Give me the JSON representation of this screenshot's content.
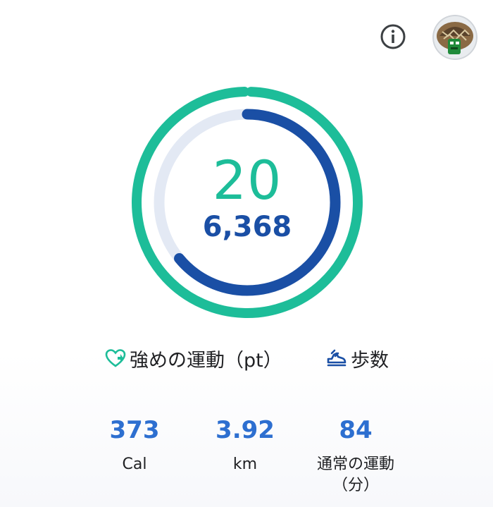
{
  "header": {
    "info_icon": "info-icon",
    "avatar_icon": "avatar"
  },
  "ring": {
    "heart_points": "20",
    "steps": "6,368",
    "heart_points_progress": 0.99,
    "steps_progress": 0.64,
    "colors": {
      "heart": "#1dbd99",
      "steps": "#1a4fa5",
      "steps_track": "#e3e9f4"
    }
  },
  "legend": {
    "heart_points_label": "強めの運動（pt）",
    "steps_label": "歩数"
  },
  "stats": [
    {
      "value": "373",
      "label": "Cal"
    },
    {
      "value": "3.92",
      "label": "km"
    },
    {
      "value": "84",
      "label": "通常の運動（分）"
    }
  ]
}
